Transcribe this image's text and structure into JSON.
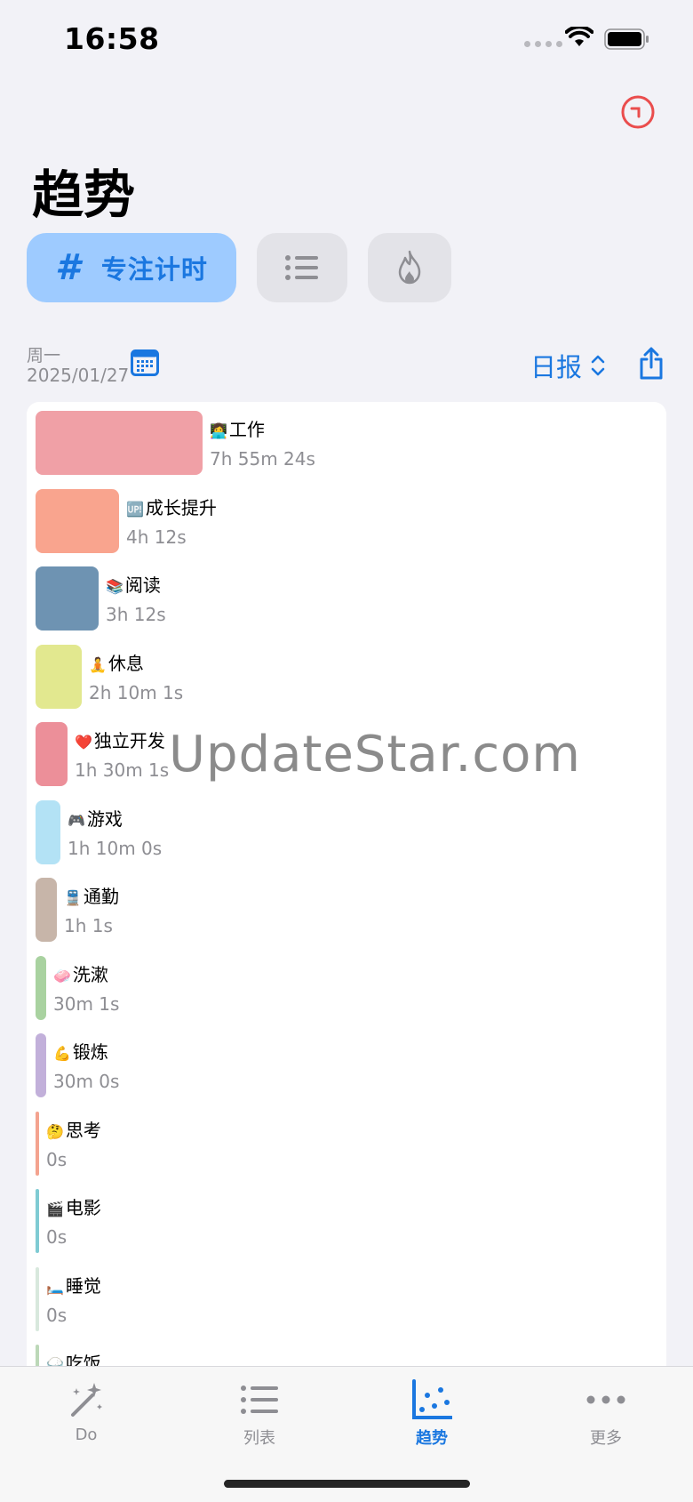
{
  "status": {
    "time": "16:58"
  },
  "header": {
    "title": "趋势"
  },
  "segments": {
    "focus_symbol": "#",
    "focus_label": "专注计时",
    "list_icon": "list-icon",
    "fire_icon": "flame-icon"
  },
  "filter": {
    "weekday": "周一",
    "date": "2025/01/27",
    "report_label": "日报"
  },
  "items": [
    {
      "emoji": "👩‍💻",
      "label": "工作",
      "duration": "7h 55m 24s",
      "color": "#f0a0a6",
      "share": 1.0
    },
    {
      "emoji": "🆙",
      "label": "成长提升",
      "duration": "4h 12s",
      "color": "#f9a48e",
      "share": 0.5
    },
    {
      "emoji": "📚",
      "label": "阅读",
      "duration": "3h 12s",
      "color": "#6e93b2",
      "share": 0.377
    },
    {
      "emoji": "🧘",
      "label": "休息",
      "duration": "2h 10m 1s",
      "color": "#e2e88f",
      "share": 0.274
    },
    {
      "emoji": "❤️",
      "label": "独立开发",
      "duration": "1h 30m 1s",
      "color": "#ec8f99",
      "share": 0.19
    },
    {
      "emoji": "🎮",
      "label": "游戏",
      "duration": "1h 10m 0s",
      "color": "#b3e2f5",
      "share": 0.147
    },
    {
      "emoji": "🚆",
      "label": "通勤",
      "duration": "1h 1s",
      "color": "#c7b5a9",
      "share": 0.126
    },
    {
      "emoji": "🧼",
      "label": "洗漱",
      "duration": "30m 1s",
      "color": "#a9d2a0",
      "share": 0.063
    },
    {
      "emoji": "💪",
      "label": "锻炼",
      "duration": "30m 0s",
      "color": "#c2b0da",
      "share": 0.063
    },
    {
      "emoji": "🤔",
      "label": "思考",
      "duration": "0s",
      "color": "#f4a38f",
      "share": 0
    },
    {
      "emoji": "🎬",
      "label": "电影",
      "duration": "0s",
      "color": "#7fcbd3",
      "share": 0
    },
    {
      "emoji": "🛏️",
      "label": "睡觉",
      "duration": "0s",
      "color": "#d8e8dd",
      "share": 0
    },
    {
      "emoji": "🍚",
      "label": "吃饭",
      "duration": "",
      "color": "#bcd8b8",
      "share": 0
    }
  ],
  "watermark": "UpdateStar.com",
  "tabs": [
    {
      "label": "Do",
      "icon": "magic-wand-icon",
      "active": false
    },
    {
      "label": "列表",
      "icon": "list-icon",
      "active": false
    },
    {
      "label": "趋势",
      "icon": "scatter-chart-icon",
      "active": true
    },
    {
      "label": "更多",
      "icon": "more-dots-icon",
      "active": false
    }
  ],
  "colors": {
    "accent": "#1a77e0",
    "timer_icon": "#ea4d4d"
  }
}
